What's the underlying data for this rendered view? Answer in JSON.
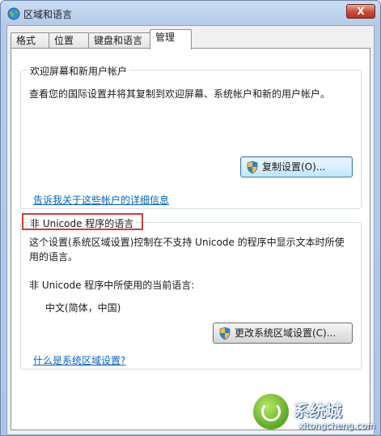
{
  "window": {
    "title": "区域和语言",
    "close_label": "X"
  },
  "tabs": [
    {
      "label": "格式"
    },
    {
      "label": "位置"
    },
    {
      "label": "键盘和语言"
    },
    {
      "label": "管理"
    }
  ],
  "welcome_group": {
    "title": "欢迎屏幕和新用户帐户",
    "description": "查看您的国际设置并将其复制到欢迎屏幕、系统帐户和新的用户帐户。",
    "copy_button": "复制设置(O)...",
    "link": "告诉我关于这些帐户的详细信息"
  },
  "nonunicode_group": {
    "title": "非 Unicode 程序的语言",
    "description_line1": "这个设置(系统区域设置)控制在不支持 Unicode 的程序中显示文本时所使",
    "description_line2": "用的语言。",
    "current_label": "非 Unicode 程序中所使用的当前语言:",
    "current_value": "中文(简体，中国)",
    "change_button": "更改系统区域设置(C)...",
    "link": "什么是系统区域设置?"
  },
  "watermark": {
    "brand": "系统城",
    "url": "xitongcheng.com"
  },
  "colors": {
    "link": "#0066cc",
    "highlight": "#d23a3a"
  }
}
